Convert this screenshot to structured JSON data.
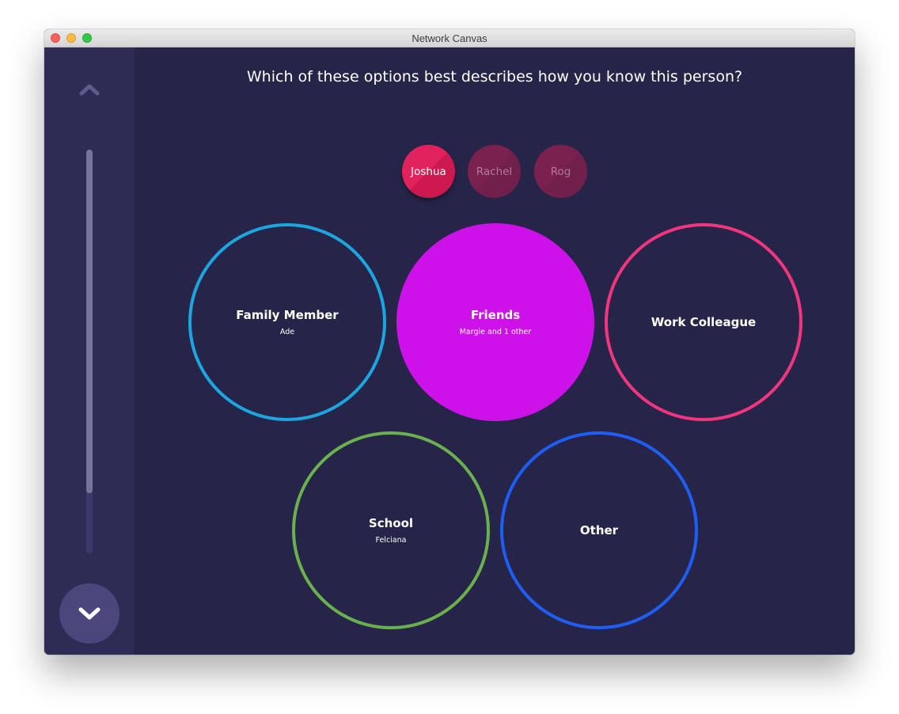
{
  "window": {
    "title": "Network Canvas"
  },
  "prompt": "Which of these options best describes how you know this person?",
  "progress": {
    "fraction": 0.85
  },
  "nodes": [
    {
      "label": "Joshua",
      "state": "active"
    },
    {
      "label": "Rachel",
      "state": "inactive"
    },
    {
      "label": "Rog",
      "state": "inactive"
    }
  ],
  "bins": [
    {
      "label": "Family Member",
      "sub": "Ade",
      "color": "#1ca6df",
      "filled": false
    },
    {
      "label": "Friends",
      "sub": "Margie and 1 other",
      "color": "#cc12e8",
      "filled": true
    },
    {
      "label": "Work Colleague",
      "sub": "",
      "color": "#f2357f",
      "filled": false
    },
    {
      "label": "School",
      "sub": "Felciana",
      "color": "#6ab04c",
      "filled": false
    },
    {
      "label": "Other",
      "sub": "",
      "color": "#1e5ef5",
      "filled": false
    }
  ],
  "icons": {
    "up": "chevron-up-icon",
    "down": "chevron-down-icon"
  }
}
